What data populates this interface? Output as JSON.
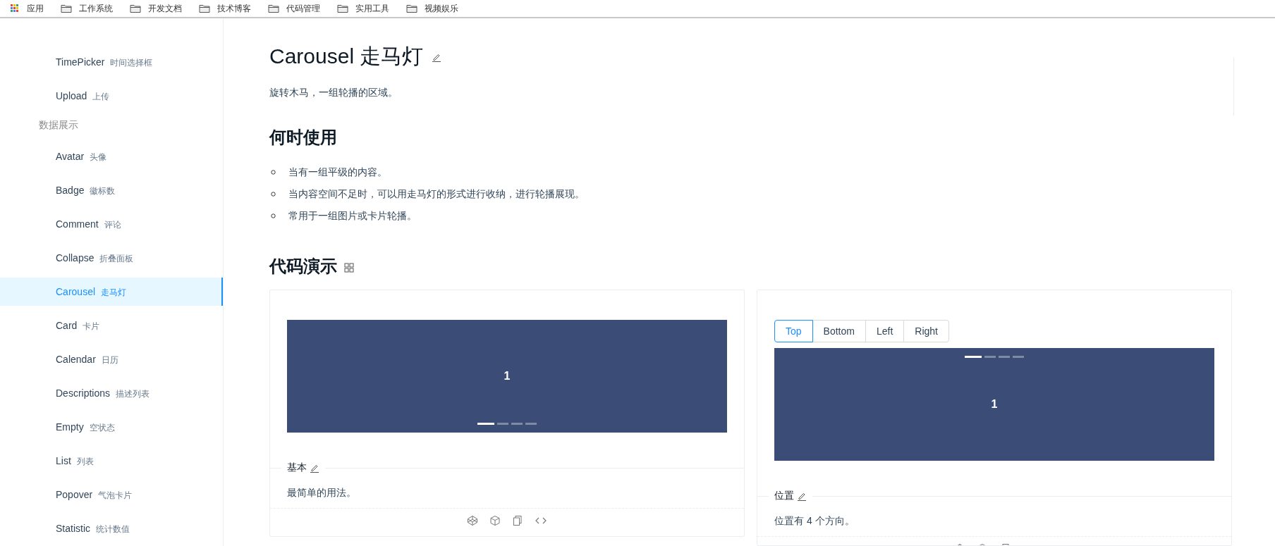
{
  "bookmarks": [
    {
      "kind": "apps",
      "label": "应用"
    },
    {
      "kind": "folder",
      "label": "工作系统"
    },
    {
      "kind": "folder",
      "label": "开发文档"
    },
    {
      "kind": "folder",
      "label": "技术博客"
    },
    {
      "kind": "folder",
      "label": "代码管理"
    },
    {
      "kind": "folder",
      "label": "实用工具"
    },
    {
      "kind": "folder",
      "label": "视频娱乐"
    }
  ],
  "sidebar": {
    "items": [
      {
        "kind": "item",
        "name": "TimePicker",
        "sub": "时间选择框",
        "selected": false
      },
      {
        "kind": "item",
        "name": "Upload",
        "sub": "上传",
        "selected": false
      },
      {
        "kind": "group",
        "name": "数据展示"
      },
      {
        "kind": "item",
        "name": "Avatar",
        "sub": "头像",
        "selected": false
      },
      {
        "kind": "item",
        "name": "Badge",
        "sub": "徽标数",
        "selected": false
      },
      {
        "kind": "item",
        "name": "Comment",
        "sub": "评论",
        "selected": false
      },
      {
        "kind": "item",
        "name": "Collapse",
        "sub": "折叠面板",
        "selected": false
      },
      {
        "kind": "item",
        "name": "Carousel",
        "sub": "走马灯",
        "selected": true
      },
      {
        "kind": "item",
        "name": "Card",
        "sub": "卡片",
        "selected": false
      },
      {
        "kind": "item",
        "name": "Calendar",
        "sub": "日历",
        "selected": false
      },
      {
        "kind": "item",
        "name": "Descriptions",
        "sub": "描述列表",
        "selected": false
      },
      {
        "kind": "item",
        "name": "Empty",
        "sub": "空状态",
        "selected": false
      },
      {
        "kind": "item",
        "name": "List",
        "sub": "列表",
        "selected": false
      },
      {
        "kind": "item",
        "name": "Popover",
        "sub": "气泡卡片",
        "selected": false
      },
      {
        "kind": "item",
        "name": "Statistic",
        "sub": "统计数值",
        "selected": false
      }
    ]
  },
  "page": {
    "title": "Carousel 走马灯",
    "intro": "旋转木马，一组轮播的区域。",
    "when_heading": "何时使用",
    "when_items": [
      "当有一组平级的内容。",
      "当内容空间不足时，可以用走马灯的形式进行收纳，进行轮播展现。",
      "常用于一组图片或卡片轮播。"
    ],
    "demo_heading": "代码演示"
  },
  "demos": [
    {
      "kind": "dots-bottom",
      "slide": "1",
      "dots": [
        {
          "selected": true
        },
        {
          "selected": false
        },
        {
          "selected": false
        },
        {
          "selected": false
        }
      ],
      "title": "基本",
      "description": "最简单的用法。"
    },
    {
      "tabs": [
        {
          "label": "Top",
          "selected": true
        },
        {
          "label": "Bottom",
          "selected": false
        },
        {
          "label": "Left",
          "selected": false
        },
        {
          "label": "Right",
          "selected": false
        }
      ],
      "kind": "dots-top",
      "slide": "1",
      "dots": [
        {
          "selected": true
        },
        {
          "selected": false
        },
        {
          "selected": false
        },
        {
          "selected": false
        }
      ],
      "title": "位置",
      "description": "位置有 4 个方向。"
    }
  ]
}
